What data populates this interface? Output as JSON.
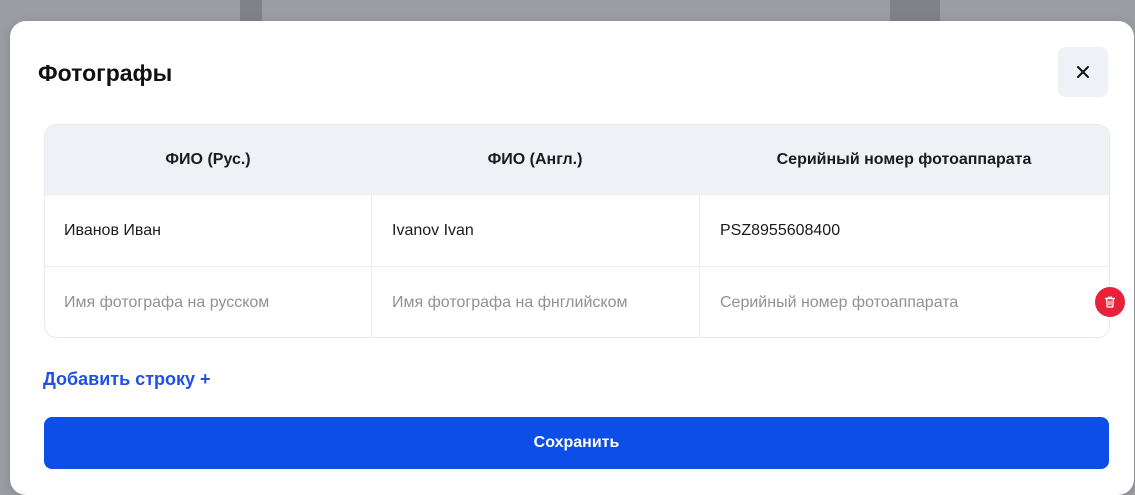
{
  "modal": {
    "title": "Фотографы",
    "close_icon": "close-icon"
  },
  "table": {
    "headers": [
      "ФИО (Рус.)",
      "ФИО (Англ.)",
      "Серийный номер фотоаппарата"
    ],
    "rows": [
      {
        "name_ru": "Иванов Иван",
        "name_en": "Ivanov Ivan",
        "serial": "PSZ8955608400"
      }
    ],
    "new_row": {
      "name_ru_placeholder": "Имя фотографа на русском",
      "name_en_placeholder": "Имя фотографа на фнглийском",
      "serial_placeholder": "Серийный номер фотоаппарата",
      "delete_icon": "trash-icon"
    }
  },
  "actions": {
    "add_row_label": "Добавить строку +",
    "save_label": "Сохранить"
  },
  "colors": {
    "accent": "#0d4ee8",
    "link": "#1f4fe6",
    "danger": "#e8203a",
    "header_bg": "#eef1f6"
  }
}
